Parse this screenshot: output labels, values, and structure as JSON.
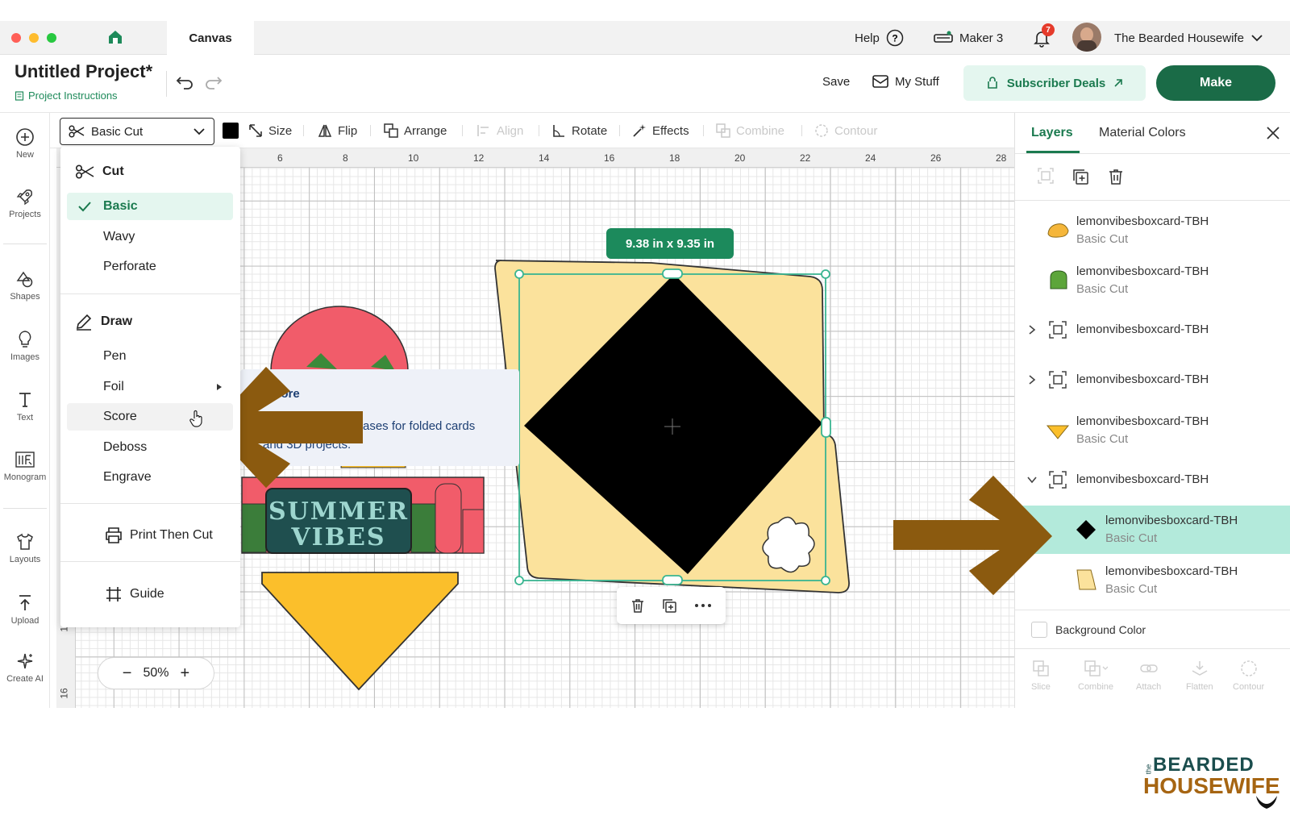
{
  "app": {
    "tab": "Canvas"
  },
  "topbar": {
    "help": "Help",
    "machine": "Maker 3",
    "notif_count": "7",
    "user": "The Bearded Housewife"
  },
  "project": {
    "title": "Untitled Project*",
    "instructions": "Project Instructions",
    "save": "Save",
    "mystuff": "My Stuff",
    "deals": "Subscriber Deals",
    "make": "Make"
  },
  "sidebar": [
    {
      "label": "New",
      "icon": "plus-circle-icon"
    },
    {
      "label": "Projects",
      "icon": "rocket-icon"
    },
    {
      "label": "Shapes",
      "icon": "shapes-icon"
    },
    {
      "label": "Images",
      "icon": "lightbulb-icon"
    },
    {
      "label": "Text",
      "icon": "text-t-icon"
    },
    {
      "label": "Monogram",
      "icon": "monogram-icon"
    },
    {
      "label": "Layouts",
      "icon": "shirt-icon"
    },
    {
      "label": "Upload",
      "icon": "upload-icon"
    },
    {
      "label": "Create AI",
      "icon": "sparkle-icon"
    }
  ],
  "toolbar": {
    "operation": "Basic Cut",
    "size": "Size",
    "flip": "Flip",
    "arrange": "Arrange",
    "align": "Align",
    "rotate": "Rotate",
    "effects": "Effects",
    "combine": "Combine",
    "contour": "Contour"
  },
  "ruler": {
    "h": [
      "6",
      "8",
      "10",
      "12",
      "14",
      "16",
      "18",
      "20",
      "22",
      "24",
      "26",
      "28"
    ],
    "v": [
      "14",
      "16"
    ]
  },
  "dropdown": {
    "cut_header": "Cut",
    "cut_items": [
      "Basic",
      "Wavy",
      "Perforate"
    ],
    "draw_header": "Draw",
    "draw_items": [
      "Pen",
      "Foil",
      "Score",
      "Deboss",
      "Engrave"
    ],
    "print_then_cut": "Print Then Cut",
    "guide": "Guide",
    "selected": "Basic",
    "hovered": "Score"
  },
  "tooltip": {
    "title": "core",
    "line1": "ases for folded cards",
    "line2": "and 3D projects."
  },
  "canvas": {
    "size_badge": "9.38  in x 9.35  in",
    "zoom": "50%",
    "card_text_1": "SUMMER",
    "card_text_2": "VIBES"
  },
  "layers_panel": {
    "tab_layers": "Layers",
    "tab_colors": "Material Colors",
    "layers": [
      {
        "name": "lemonvibesboxcard-TBH",
        "sub": "Basic Cut"
      },
      {
        "name": "lemonvibesboxcard-TBH",
        "sub": "Basic Cut"
      },
      {
        "name": "lemonvibesboxcard-TBH",
        "sub": ""
      },
      {
        "name": "lemonvibesboxcard-TBH",
        "sub": ""
      },
      {
        "name": "lemonvibesboxcard-TBH",
        "sub": "Basic Cut"
      },
      {
        "name": "lemonvibesboxcard-TBH",
        "sub": ""
      },
      {
        "name": "lemonvibesboxcard-TBH",
        "sub": "Basic Cut"
      },
      {
        "name": "lemonvibesboxcard-TBH",
        "sub": "Basic Cut"
      }
    ],
    "background_color": "Background Color",
    "bottom_tools": [
      "Slice",
      "Combine",
      "Attach",
      "Flatten",
      "Contour"
    ]
  },
  "brand": {
    "line1": "BEARDED",
    "line2": "HOUSEWIFE",
    "prefix": "the"
  },
  "colors": {
    "accent": "#1a6b47",
    "highlight": "#b3eadb",
    "arrow": "#8b5a0f",
    "card_yellow": "#fbe29c"
  }
}
